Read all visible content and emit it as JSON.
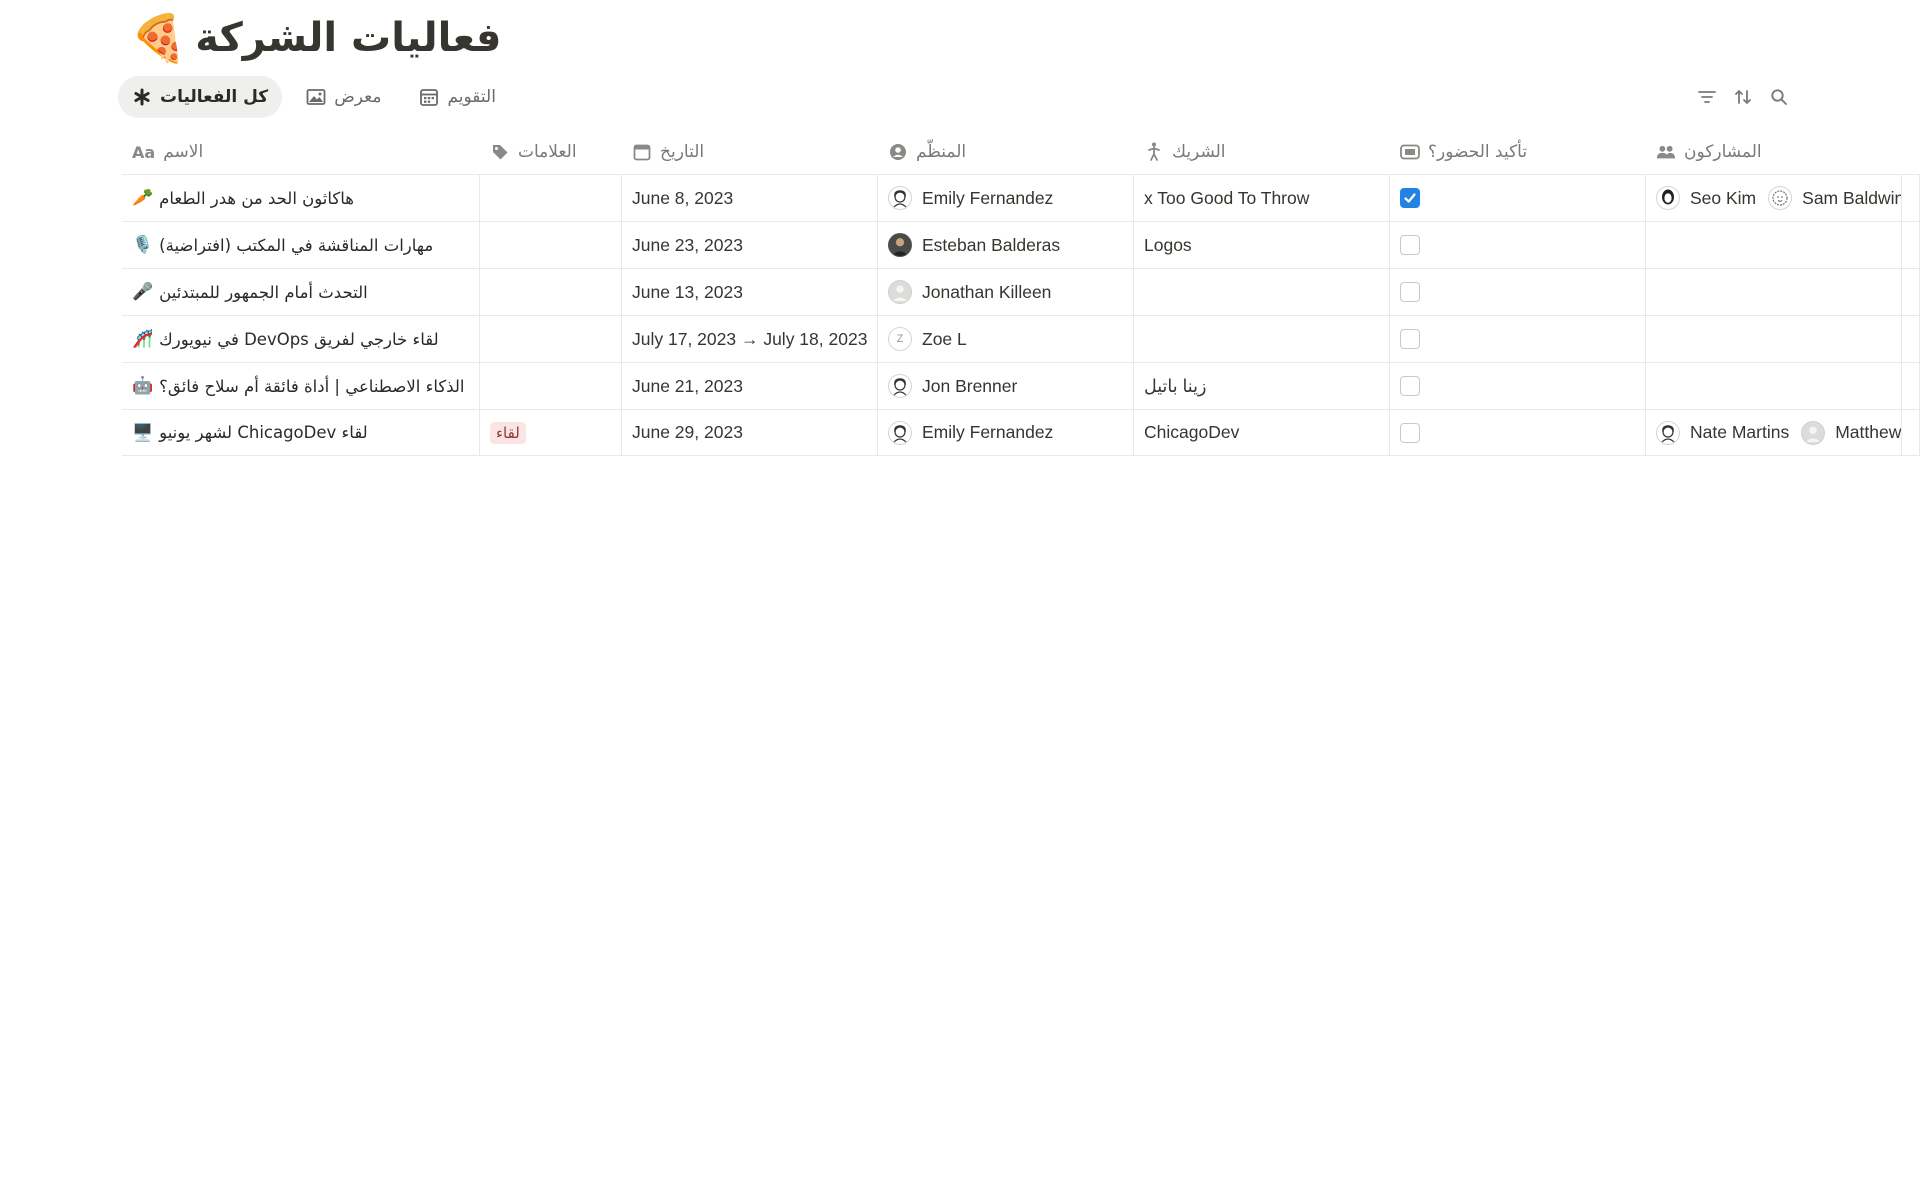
{
  "page": {
    "title": "فعاليات الشركة",
    "title_emoji": "🍕"
  },
  "views": [
    {
      "label": "كل الفعاليات",
      "icon": "asterisk-icon",
      "active": true
    },
    {
      "label": "معرض",
      "icon": "gallery-icon",
      "active": false
    },
    {
      "label": "التقويم",
      "icon": "calendar-icon",
      "active": false
    }
  ],
  "toolbar": [
    "filter-icon",
    "sort-icon",
    "search-icon"
  ],
  "columns": {
    "name": "الاسم",
    "name_icon_text": "Aa",
    "tags": "العلامات",
    "date": "التاريخ",
    "organizer": "المنظّم",
    "partner": "الشريك",
    "confirm": "تأكيد الحضور؟",
    "participants": "المشاركون"
  },
  "rows": [
    {
      "emoji": "🥕",
      "name": "هاكاثون الحد من هدر الطعام",
      "tag": "",
      "date": "June 8, 2023",
      "organizer": "Emily Fernandez",
      "partner": "x Too Good To Throw",
      "confirmed": true,
      "participants": [
        "Seo Kim",
        "Sam Baldwin"
      ]
    },
    {
      "emoji": "🎙️",
      "name": "مهارات المناقشة في المكتب (افتراضية)",
      "tag": "",
      "date": "June 23, 2023",
      "organizer": "Esteban Balderas",
      "partner": "Logos",
      "confirmed": false,
      "participants": []
    },
    {
      "emoji": "🎤",
      "name": "التحدث أمام الجمهور للمبتدئين",
      "tag": "",
      "date": "June 13, 2023",
      "organizer": "Jonathan Killeen",
      "partner": "",
      "confirmed": false,
      "participants": []
    },
    {
      "emoji": "🎢",
      "name": "في نيويورك DevOps لقاء خارجي لفريق",
      "tag": "",
      "date": "July 17, 2023 → July 18, 2023",
      "organizer": "Zoe L",
      "organizer_initial": "Z",
      "partner": "",
      "confirmed": false,
      "participants": []
    },
    {
      "emoji": "🤖",
      "name": "الذكاء الاصطناعي | أداة فائقة أم سلاح فائق؟",
      "tag": "",
      "date": "June 21, 2023",
      "organizer": "Jon Brenner",
      "partner": "زينا باتيل",
      "confirmed": false,
      "participants": []
    },
    {
      "emoji": "🖥️",
      "name": "لشهر يونيو ChicagoDev لقاء",
      "tag": "لقاء",
      "date": "June 29, 2023",
      "organizer": "Emily Fernandez",
      "partner": "ChicagoDev",
      "confirmed": false,
      "participants": [
        "Nate Martins",
        "Matthew"
      ]
    }
  ]
}
